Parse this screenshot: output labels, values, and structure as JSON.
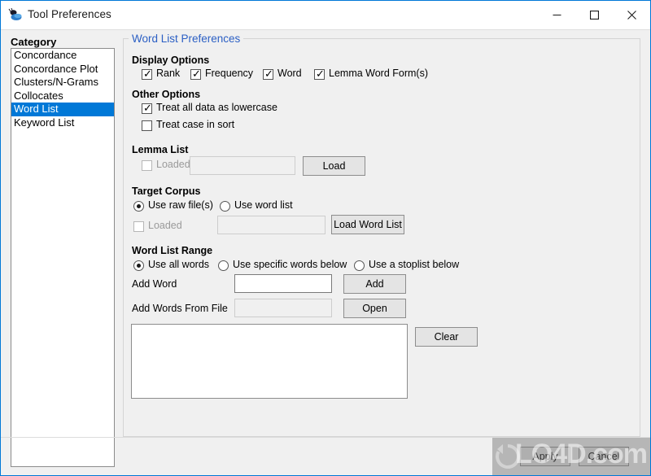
{
  "window": {
    "title": "Tool Preferences",
    "icon": "ant-app-icon",
    "accent_color": "#0078d7",
    "background_color": "#f0f0f0",
    "controls": {
      "minimize": "minimize-icon",
      "maximize": "maximize-icon",
      "close": "close-icon"
    }
  },
  "sidebar": {
    "header": "Category",
    "items": [
      {
        "label": "Concordance",
        "selected": false
      },
      {
        "label": "Concordance Plot",
        "selected": false
      },
      {
        "label": "Clusters/N-Grams",
        "selected": false
      },
      {
        "label": "Collocates",
        "selected": false
      },
      {
        "label": "Word List",
        "selected": true
      },
      {
        "label": "Keyword List",
        "selected": false
      }
    ],
    "selected_item": "Word List",
    "selection_color": "#0078d7"
  },
  "main": {
    "groupbox_title": "Word List Preferences",
    "groupbox_title_color": "#2b5fc4",
    "display_options": {
      "heading": "Display Options",
      "checkboxes": [
        {
          "label": "Rank",
          "checked": true
        },
        {
          "label": "Frequency",
          "checked": true
        },
        {
          "label": "Word",
          "checked": true
        },
        {
          "label": "Lemma Word Form(s)",
          "checked": true
        }
      ]
    },
    "other_options": {
      "heading": "Other Options",
      "checkboxes": [
        {
          "label": "Treat all data as lowercase",
          "checked": true
        },
        {
          "label": "Treat case in sort",
          "checked": false
        }
      ]
    },
    "lemma_list": {
      "heading": "Lemma List",
      "loaded_label": "Loaded",
      "loaded_checked": false,
      "loaded_disabled": true,
      "path_value": "",
      "path_placeholder": "",
      "path_disabled": true,
      "load_button": "Load"
    },
    "target_corpus": {
      "heading": "Target Corpus",
      "radios": [
        {
          "label": "Use raw file(s)",
          "selected": true
        },
        {
          "label": "Use word list",
          "selected": false
        }
      ],
      "loaded_label": "Loaded",
      "loaded_checked": false,
      "loaded_disabled": true,
      "path_value": "",
      "path_disabled": true,
      "load_button": "Load Word List"
    },
    "word_list_range": {
      "heading": "Word List Range",
      "radios": [
        {
          "label": "Use all words",
          "selected": true
        },
        {
          "label": "Use specific words below",
          "selected": false
        },
        {
          "label": "Use a stoplist below",
          "selected": false
        }
      ],
      "add_word_label": "Add Word",
      "add_word_value": "",
      "add_word_disabled": false,
      "add_button": "Add",
      "add_file_label": "Add Words From File",
      "add_file_value": "",
      "add_file_disabled": true,
      "open_button": "Open",
      "stoplist_value": "",
      "clear_button": "Clear"
    }
  },
  "footer": {
    "apply_button": "Apply",
    "cancel_button": "Cancel"
  },
  "watermark": {
    "text": "LO4D.com",
    "logo": "circular-arrow-logo"
  }
}
